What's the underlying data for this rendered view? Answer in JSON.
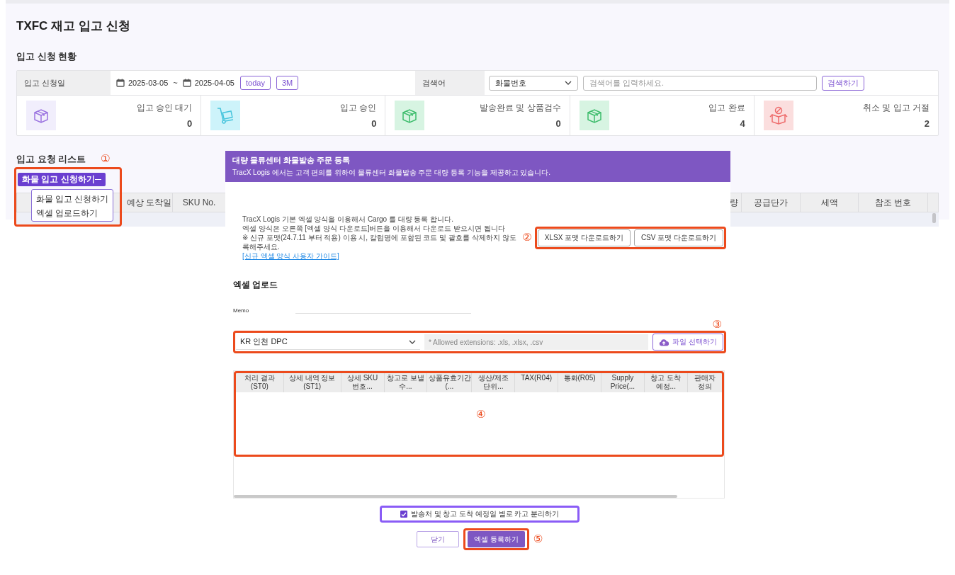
{
  "page": {
    "title": "TXFC 재고 입고 신청",
    "status_heading": "입고 신청 현황",
    "filter": {
      "date_label": "입고 신청일",
      "date_from": "2025-03-05",
      "separator": "~",
      "date_to": "2025-04-05",
      "range_buttons": [
        "today",
        "3M"
      ],
      "search_label": "검색어",
      "search_type": "화물번호",
      "search": {
        "placeholder": "검색어를 입력하세요."
      },
      "search_button": "검색하기"
    },
    "stats": [
      {
        "kind": "waiting",
        "label": "입고 승인 대기",
        "count": "0"
      },
      {
        "kind": "approved",
        "label": "입고 승인",
        "count": "0"
      },
      {
        "kind": "shipped",
        "label": "발송완료 및 상품검수",
        "count": "0"
      },
      {
        "kind": "done",
        "label": "입고 완료",
        "count": "4"
      },
      {
        "kind": "cancelled",
        "label": "취소 및 입고 거절",
        "count": "2"
      }
    ],
    "list_heading": "입고 요청 리스트",
    "add_button": "화물 입고 신청하기",
    "add_menu": [
      {
        "label": "화물 입고 신청하기"
      },
      {
        "label": "엑셀 업로드하기"
      }
    ],
    "table": {
      "columns_left": [
        "예상 도착일",
        "SKU No."
      ],
      "columns_right": [
        "량",
        "공급단가",
        "세액",
        "참조 번호"
      ]
    }
  },
  "modal": {
    "title": "대량 물류센터 화물발송 주문 등록",
    "subtitle": "TracX Logis 에서는 고객 편의를 위하여 물류센터 화물발송 주문 대량 등록 기능을 제공하고 있습니다.",
    "notes": [
      "TracX Logis 기본 엑셀 양식을 이용해서 Cargo 를 대량 등록 합니다.",
      "엑셀 양식은 오른쪽 [엑셀 양식 다운로드]버튼을 이용해서 다운로드 받으시면 됩니다",
      "※ 신규 포맷(24.7.11 부터 적용) 이용 시, 칼럼명에 포함된 코드 및 괄호를 삭제하지 않도록해주세요."
    ],
    "guide_link": "[신규 엑셀 양식 사용자 가이드]",
    "download_buttons": [
      "XLSX 포맷 다운로드하기",
      "CSV 포맷 다운로드하기"
    ],
    "upload_heading": "엑셀 업로드",
    "memo_label": "Memo",
    "center": "KR 인천 DPC",
    "file": {
      "placeholder": "* Allowed extensions: .xls, .xlsx, .csv"
    },
    "file_button": "파일 선택하기",
    "grid_columns": [
      "처리 결과(ST0)",
      "상세 내역 정보(ST1)",
      "상세 SKU 번호...",
      "창고로 보낼 수...",
      "상품유효기간(...",
      "생산/제조 단위...",
      "TAX(R04)",
      "통화(R05)",
      "Supply Price(...",
      "창고 도착 예정...",
      "판매자 정의"
    ],
    "split_option": {
      "label": "발송처 및 창고 도착 예정일 별로 카고 분리하기",
      "checked": true
    },
    "close_button": "닫기",
    "submit_button": "엑셀 등록하기"
  },
  "annotations": {
    "list_menu": "①",
    "download": "②",
    "upload_row": "③",
    "grid": "④",
    "submit": "⑤"
  }
}
